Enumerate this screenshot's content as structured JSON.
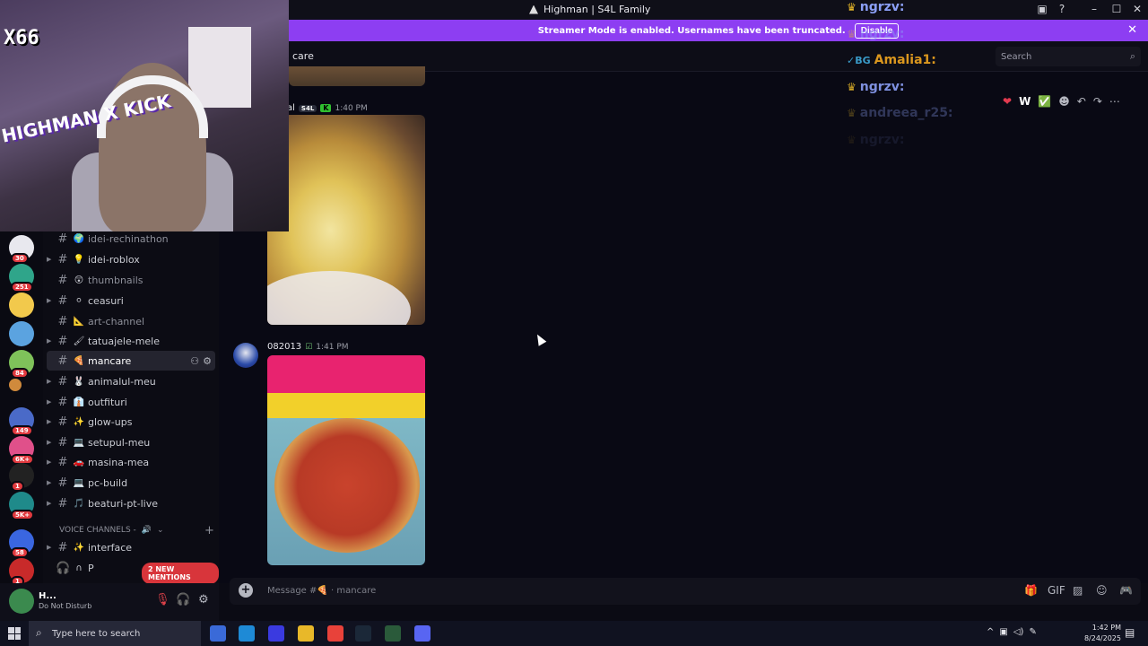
{
  "window": {
    "title": "Highman | S4L Family",
    "minimize": "–",
    "maximize": "☐",
    "close": "✕"
  },
  "banner": {
    "text": "Streamer Mode is enabled. Usernames have been truncated.",
    "button": "Disable",
    "close": "✕",
    "color": "#8d3ef2"
  },
  "header": {
    "channel_fragment": "care",
    "search_placeholder": "Search"
  },
  "webcam": {
    "tag": "X66",
    "overlay": "HIGHMAN X KICK"
  },
  "servers": [
    {
      "badge": "30",
      "color": "#e8e8ee"
    },
    {
      "badge": "251",
      "color": "#2fa58a"
    },
    {
      "badge": "",
      "color": "#f2c94c"
    },
    {
      "badge": "",
      "color": "#5ba3e0"
    },
    {
      "badge": "84",
      "color": "#7fc25a"
    },
    {
      "badge": "",
      "color": "#d08a3c"
    },
    {
      "badge": "149",
      "color": "#4a6ac8"
    },
    {
      "badge": "6K+",
      "color": "#e0508a"
    },
    {
      "badge": "1",
      "color": "#222"
    },
    {
      "badge": "5K+",
      "color": "#1f8a8a"
    },
    {
      "badge": "58",
      "color": "#3a66e0"
    },
    {
      "badge": "1",
      "color": "#c82a2a"
    }
  ],
  "channels": [
    {
      "label": "idei-rechinathon",
      "emoji": "🌍",
      "dim": true
    },
    {
      "label": "idei-roblox",
      "emoji": "💡",
      "dim": false
    },
    {
      "label": "thumbnails",
      "emoji": "😲",
      "dim": true
    },
    {
      "label": "ceasuri",
      "emoji": "⚪",
      "dim": false
    },
    {
      "label": "art-channel",
      "emoji": "📐",
      "dim": true
    },
    {
      "label": "tatuajele-mele",
      "emoji": "🖌",
      "dim": false
    },
    {
      "label": "mancare",
      "emoji": "🍕",
      "dim": false,
      "active": true
    },
    {
      "label": "animalul-meu",
      "emoji": "🐰",
      "dim": false
    },
    {
      "label": "outfituri",
      "emoji": "👔",
      "dim": false
    },
    {
      "label": "glow-ups",
      "emoji": "✨",
      "dim": false
    },
    {
      "label": "setupul-meu",
      "emoji": "💻",
      "dim": false
    },
    {
      "label": "masina-mea",
      "emoji": "🚗",
      "dim": false
    },
    {
      "label": "pc-build",
      "emoji": "💻",
      "dim": false
    },
    {
      "label": "beaturi-pt-live",
      "emoji": "🎵",
      "dim": false
    }
  ],
  "voice_header": "VOICE CHANNELS -",
  "voice_channel": {
    "label": "interface",
    "emoji": "✨"
  },
  "voice_partial": "P",
  "mentions_pill": "2 NEW MENTIONS",
  "user_panel": {
    "name": "H...",
    "status": "Do Not Disturb"
  },
  "messages": [
    {
      "author": "al",
      "tag": "S4L",
      "time": "1:40 PM"
    },
    {
      "author": "082013",
      "time": "1:41 PM"
    }
  ],
  "composer": {
    "placeholder": "Message #🍕 · mancare"
  },
  "overlay_chat": [
    {
      "name": "ngrzv:",
      "opacity": "1"
    },
    {
      "name": "ngrzv:",
      "opacity": "0.45"
    },
    {
      "name": "Amalia1:",
      "opacity": "0.85"
    },
    {
      "name": "ngrzv:",
      "opacity": "0.9"
    },
    {
      "name": "andreea_r25:",
      "opacity": "0.3"
    },
    {
      "name": "ngrzv:",
      "opacity": "0.1"
    }
  ],
  "reactions": [
    "❤",
    "W",
    "✅",
    "☻",
    "↶",
    "↷",
    "⋯"
  ],
  "taskbar": {
    "search": "Type here to search",
    "time": "1:42 PM",
    "date": "8/24/2025"
  },
  "icons": {
    "hash": "#",
    "search": "⌕",
    "settings": "⚙",
    "add": "+"
  }
}
